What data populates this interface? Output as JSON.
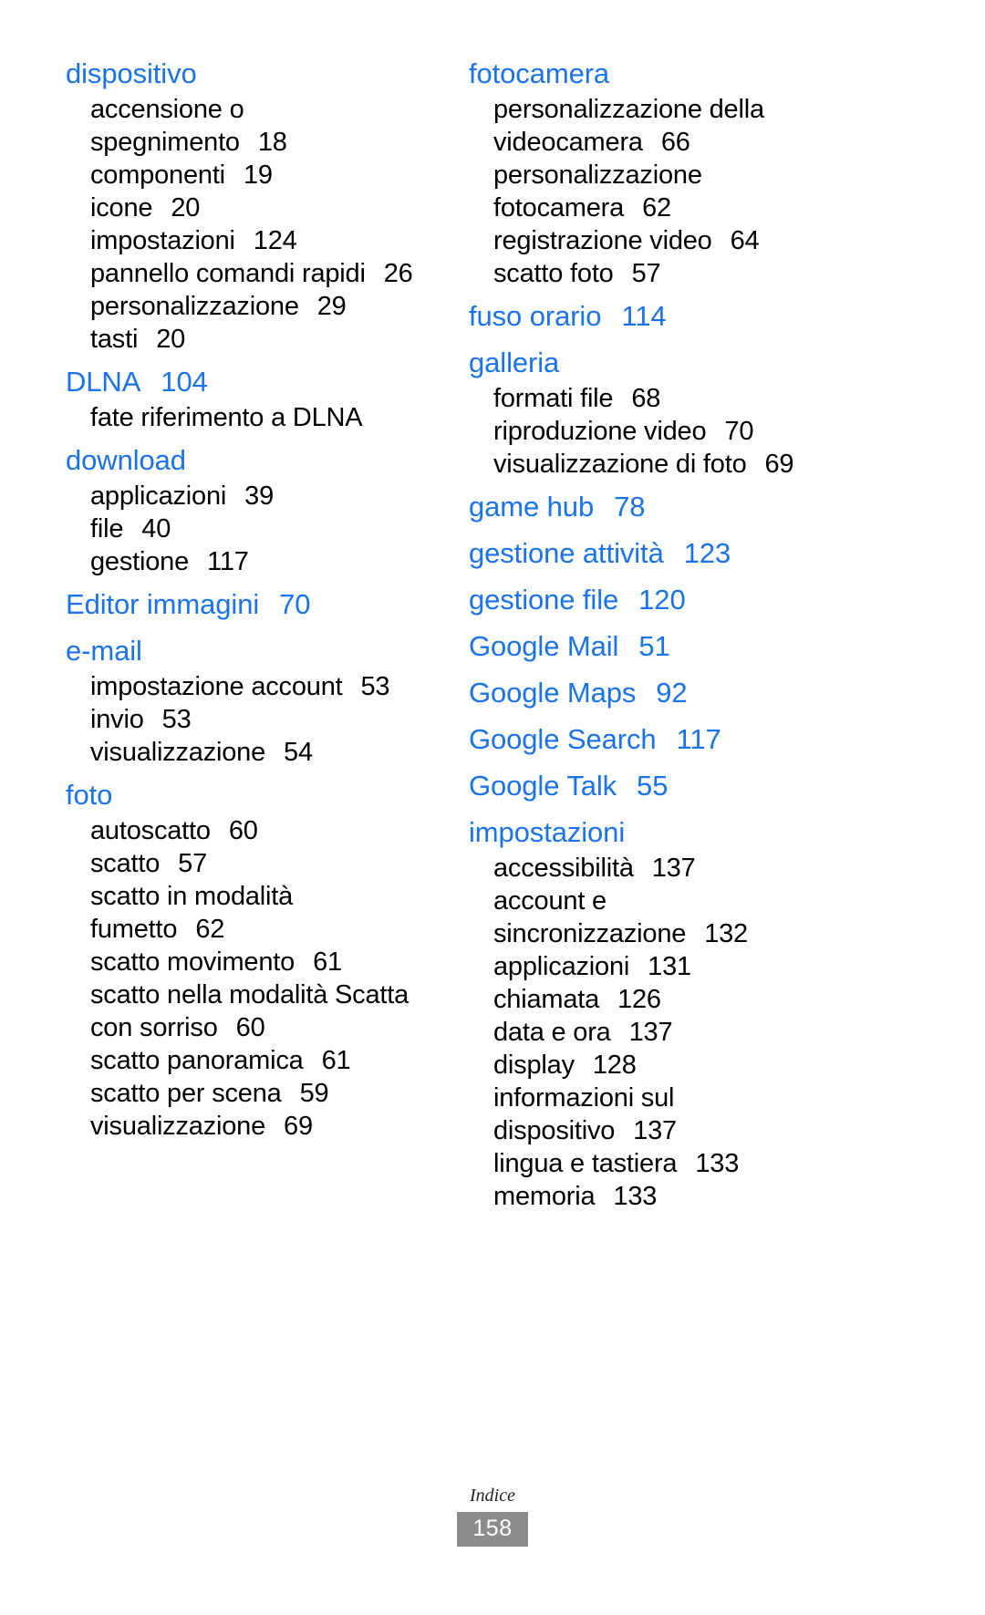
{
  "document": {
    "footer_label": "Indice",
    "page_number": "158",
    "accent_color": "#1a73ea",
    "page_box_color": "#8c8c8c"
  },
  "columns": [
    {
      "name": "left-column",
      "entries": [
        {
          "term": "dispositivo",
          "page": "",
          "subentries": [
            {
              "label": "accensione o",
              "page": ""
            },
            {
              "label": "spegnimento",
              "page": "18"
            },
            {
              "label": "componenti",
              "page": "19"
            },
            {
              "label": "icone",
              "page": "20"
            },
            {
              "label": "impostazioni",
              "page": "124"
            },
            {
              "label": "pannello comandi rapidi",
              "page": "26"
            },
            {
              "label": "personalizzazione",
              "page": "29"
            },
            {
              "label": "tasti",
              "page": "20"
            }
          ]
        },
        {
          "term": "DLNA",
          "page": "104",
          "subentries": [
            {
              "label": "fate riferimento a DLNA",
              "page": ""
            }
          ]
        },
        {
          "term": "download",
          "page": "",
          "subentries": [
            {
              "label": "applicazioni",
              "page": "39"
            },
            {
              "label": "file",
              "page": "40"
            },
            {
              "label": "gestione",
              "page": "117"
            }
          ]
        },
        {
          "term": "Editor immagini",
          "page": "70",
          "subentries": []
        },
        {
          "term": "e-mail",
          "page": "",
          "subentries": [
            {
              "label": "impostazione account",
              "page": "53"
            },
            {
              "label": "invio",
              "page": "53"
            },
            {
              "label": "visualizzazione",
              "page": "54"
            }
          ]
        },
        {
          "term": "foto",
          "page": "",
          "subentries": [
            {
              "label": "autoscatto",
              "page": "60"
            },
            {
              "label": "scatto",
              "page": "57"
            },
            {
              "label": "scatto in modalità",
              "page": ""
            },
            {
              "label": "fumetto",
              "page": "62"
            },
            {
              "label": "scatto movimento",
              "page": "61"
            },
            {
              "label": "scatto nella modalità Scatta",
              "page": ""
            },
            {
              "label": "con sorriso",
              "page": "60"
            },
            {
              "label": "scatto panoramica",
              "page": "61"
            },
            {
              "label": "scatto per scena",
              "page": "59"
            },
            {
              "label": "visualizzazione",
              "page": "69"
            }
          ]
        }
      ]
    },
    {
      "name": "right-column",
      "entries": [
        {
          "term": "fotocamera",
          "page": "",
          "subentries": [
            {
              "label": "personalizzazione della",
              "page": ""
            },
            {
              "label": "videocamera",
              "page": "66"
            },
            {
              "label": "personalizzazione",
              "page": ""
            },
            {
              "label": "fotocamera",
              "page": "62"
            },
            {
              "label": "registrazione video",
              "page": "64"
            },
            {
              "label": "scatto foto",
              "page": "57"
            }
          ]
        },
        {
          "term": "fuso orario",
          "page": "114",
          "subentries": []
        },
        {
          "term": "galleria",
          "page": "",
          "subentries": [
            {
              "label": "formati file",
              "page": "68"
            },
            {
              "label": "riproduzione video",
              "page": "70"
            },
            {
              "label": "visualizzazione di foto",
              "page": "69"
            }
          ]
        },
        {
          "term": "game hub",
          "page": "78",
          "subentries": []
        },
        {
          "term": "gestione attività",
          "page": "123",
          "subentries": []
        },
        {
          "term": "gestione file",
          "page": "120",
          "subentries": []
        },
        {
          "term": "Google Mail",
          "page": "51",
          "subentries": []
        },
        {
          "term": "Google Maps",
          "page": "92",
          "subentries": []
        },
        {
          "term": "Google Search",
          "page": "117",
          "subentries": []
        },
        {
          "term": "Google Talk",
          "page": "55",
          "subentries": []
        },
        {
          "term": "impostazioni",
          "page": "",
          "subentries": [
            {
              "label": "accessibilità",
              "page": "137"
            },
            {
              "label": "account e",
              "page": ""
            },
            {
              "label": "sincronizzazione",
              "page": "132"
            },
            {
              "label": "applicazioni",
              "page": "131"
            },
            {
              "label": "chiamata",
              "page": "126"
            },
            {
              "label": "data e ora",
              "page": "137"
            },
            {
              "label": "display",
              "page": "128"
            },
            {
              "label": "informazioni sul",
              "page": ""
            },
            {
              "label": "dispositivo",
              "page": "137"
            },
            {
              "label": "lingua e tastiera",
              "page": "133"
            },
            {
              "label": "memoria",
              "page": "133"
            }
          ]
        }
      ]
    }
  ]
}
